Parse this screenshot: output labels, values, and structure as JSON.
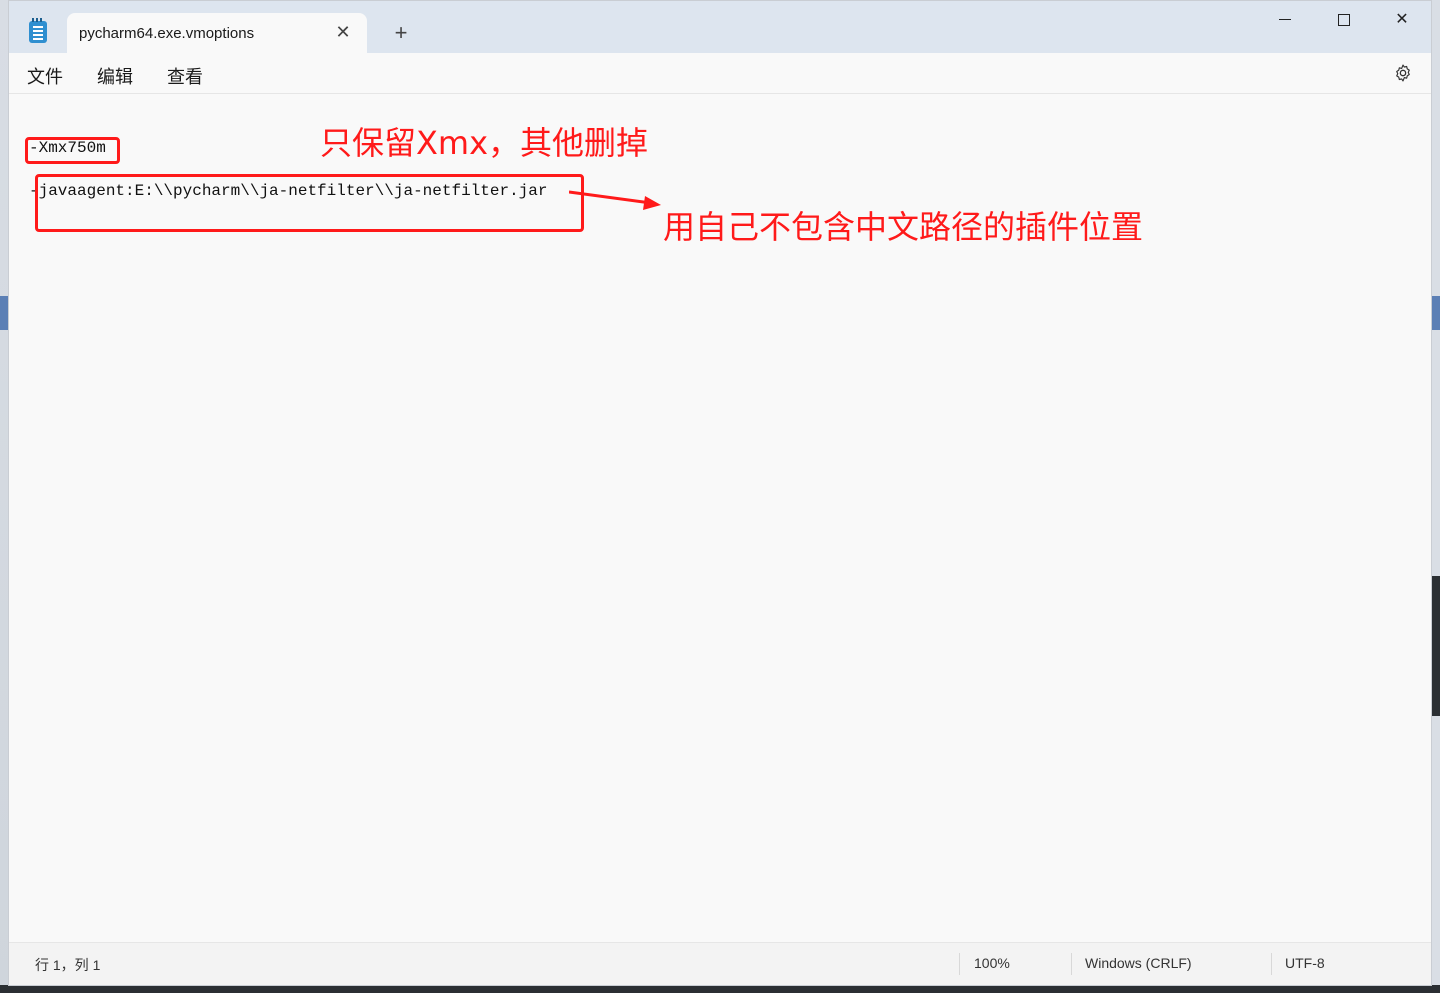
{
  "tab": {
    "title": "pycharm64.exe.vmoptions",
    "close": "✕",
    "new": "+"
  },
  "window_controls": {
    "close": "✕"
  },
  "menu": {
    "file": "文件",
    "edit": "编辑",
    "view": "查看"
  },
  "editor": {
    "lines": [
      "-Xmx750m",
      "-javaagent:E:\\\\pycharm\\\\ja-netfilter\\\\ja-netfilter.jar"
    ]
  },
  "annotations": {
    "note1": "只保留Xmx，其他删掉",
    "note2": "用自己不包含中文路径的插件位置"
  },
  "status": {
    "position": "行 1，列 1",
    "zoom": "100%",
    "line_ending": "Windows (CRLF)",
    "encoding": "UTF-8"
  },
  "colors": {
    "annotation": "#ff1a1a",
    "titlebar": "#dde5ef"
  }
}
